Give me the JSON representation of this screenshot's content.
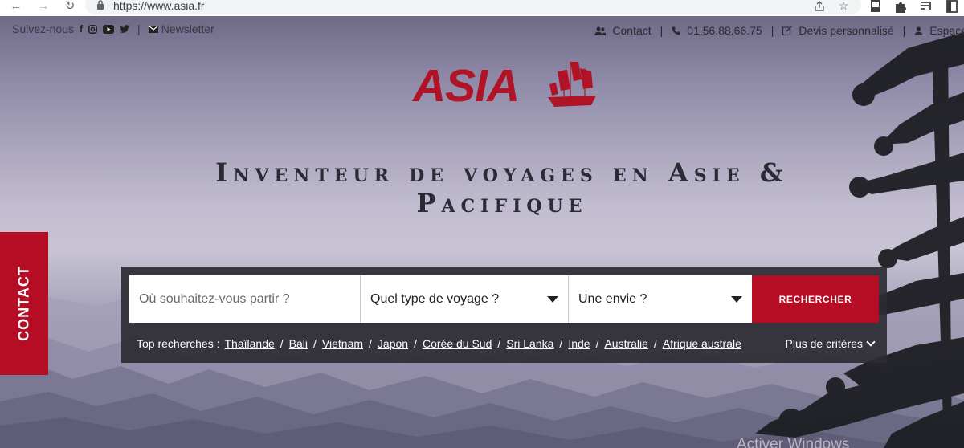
{
  "browser": {
    "url": "https://www.asia.fr",
    "icons": [
      "back-arrow-icon",
      "forward-arrow-icon",
      "reload-icon",
      "lock-icon",
      "share-icon",
      "star-icon",
      "extension-icon",
      "puzzle-icon",
      "reading-list-icon",
      "sidebar-icon"
    ]
  },
  "social": {
    "label": "Suivez-nous",
    "icons": [
      "facebook-icon",
      "instagram-icon",
      "youtube-icon",
      "twitter-icon"
    ],
    "newsletter": "Newsletter"
  },
  "topnav": {
    "contact": "Contact",
    "phone": "01.56.88.66.75",
    "quote": "Devis personnalisé",
    "account": "Espace"
  },
  "brand": {
    "name": "ASIA",
    "color": "#b01326"
  },
  "headline": "Inventeur de voyages en Asie & Pacifique",
  "contact_tab": "CONTACT",
  "search": {
    "destination_placeholder": "Où souhaitez-vous partir ?",
    "trip_type": "Quel type de voyage ?",
    "desire": "Une envie ?",
    "button": "RECHERCHER",
    "top_label": "Top recherches :",
    "top_items": [
      "Thaïlande",
      "Bali",
      "Vietnam",
      "Japon",
      "Corée du Sud",
      "Sri Lanka",
      "Inde",
      "Australie",
      "Afrique australe"
    ],
    "more": "Plus de critères"
  },
  "watermark": "Activer Windows",
  "colors": {
    "accent": "#b40d24",
    "panel": "#2d2b32"
  }
}
